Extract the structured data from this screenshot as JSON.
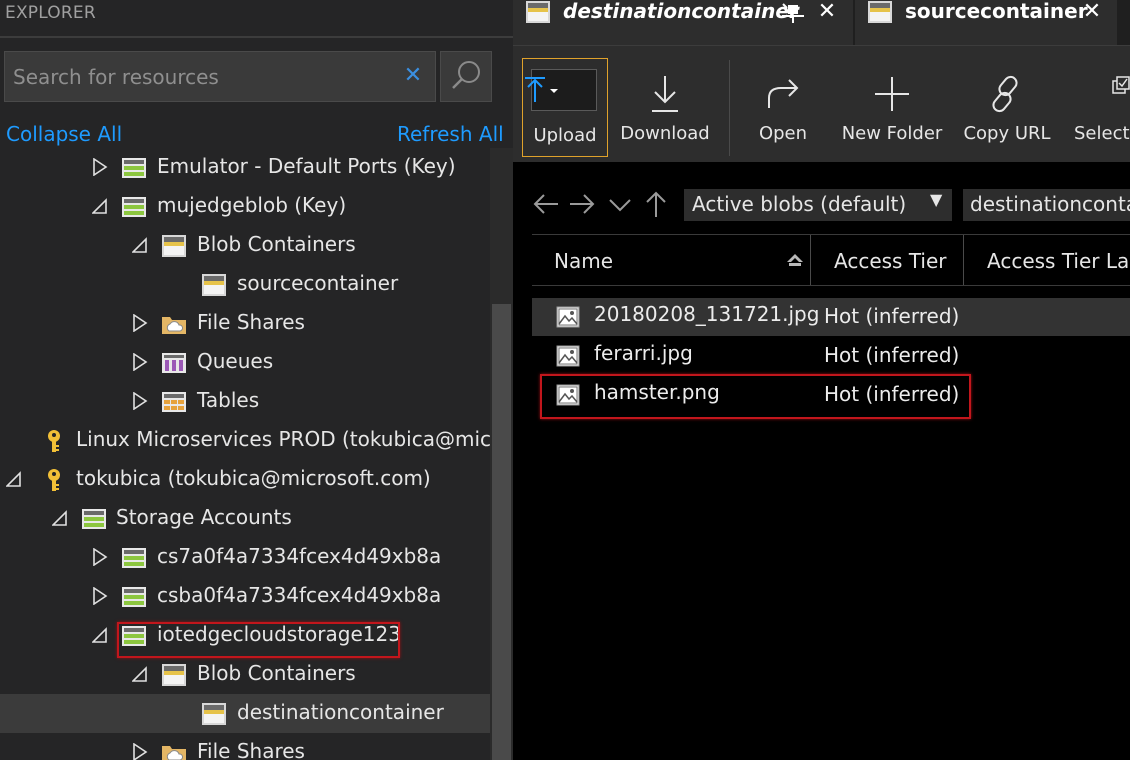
{
  "explorer": {
    "header": "EXPLORER",
    "search_placeholder": "Search for resources",
    "collapse_all": "Collapse All",
    "refresh_all": "Refresh All"
  },
  "tree": [
    {
      "label": "Emulator - Default Ports (Key)",
      "icon": "storage-account-icon",
      "expanded": false
    },
    {
      "label": "mujedgeblob (Key)",
      "icon": "storage-account-icon",
      "expanded": true
    },
    {
      "label": "Blob Containers",
      "icon": "blob-containers-icon",
      "expanded": true
    },
    {
      "label": "sourcecontainer",
      "icon": "blob-container-icon"
    },
    {
      "label": "File Shares",
      "icon": "file-shares-icon",
      "expanded": false
    },
    {
      "label": "Queues",
      "icon": "queues-icon",
      "expanded": false
    },
    {
      "label": "Tables",
      "icon": "tables-icon",
      "expanded": false
    },
    {
      "label": "Linux Microservices PROD (tokubica@micros",
      "icon": "key-icon"
    },
    {
      "label": "tokubica (tokubica@microsoft.com)",
      "icon": "key-icon",
      "expanded": true
    },
    {
      "label": "Storage Accounts",
      "icon": "storage-accounts-icon",
      "expanded": true
    },
    {
      "label": "cs7a0f4a7334fcex4d49xb8a",
      "icon": "storage-account-icon",
      "expanded": false
    },
    {
      "label": "csba0f4a7334fcex4d49xb8a",
      "icon": "storage-account-icon",
      "expanded": false
    },
    {
      "label": "iotedgecloudstorage123",
      "icon": "storage-account-icon",
      "expanded": true
    },
    {
      "label": "Blob Containers",
      "icon": "blob-containers-icon",
      "expanded": true
    },
    {
      "label": "destinationcontainer",
      "icon": "blob-container-icon",
      "selected": true
    },
    {
      "label": "File Shares",
      "icon": "file-shares-icon",
      "expanded": false
    }
  ],
  "tabs": [
    {
      "label": "destinationcontainer",
      "active": true
    },
    {
      "label": "sourcecontainer",
      "active": false
    }
  ],
  "toolbar": {
    "upload": "Upload",
    "download": "Download",
    "open": "Open",
    "new_folder": "New Folder",
    "copy_url": "Copy URL",
    "select_all": "Select A"
  },
  "nav": {
    "blob_filter": "Active blobs (default)",
    "path": "destinationcontainer"
  },
  "grid": {
    "columns": [
      "Name",
      "Access Tier",
      "Access Tier Last"
    ],
    "rows": [
      {
        "name": "20180208_131721.jpg",
        "tier": "Hot (inferred)"
      },
      {
        "name": "ferarri.jpg",
        "tier": "Hot (inferred)"
      },
      {
        "name": "hamster.png",
        "tier": "Hot (inferred)"
      }
    ]
  },
  "colors": {
    "accent": "#1e9bff",
    "highlight": "#c2161c",
    "upload_border": "#e0a22b"
  }
}
